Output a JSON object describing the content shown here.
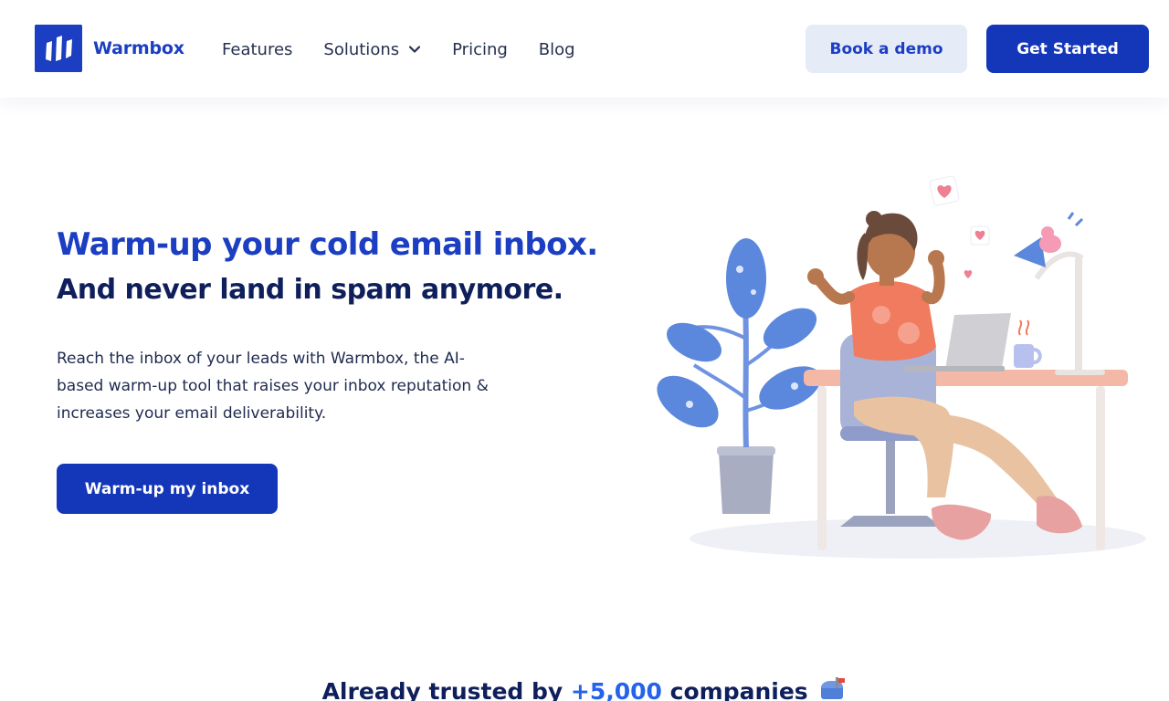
{
  "brand": {
    "name": "Warmbox",
    "color": "#1b3ec2"
  },
  "nav": {
    "items": [
      {
        "label": "Features"
      },
      {
        "label": "Solutions",
        "icon": "chevron-down-icon"
      },
      {
        "label": "Pricing"
      },
      {
        "label": "Blog"
      }
    ]
  },
  "header_actions": {
    "demo_label": "Book a demo",
    "start_label": "Get Started"
  },
  "hero": {
    "title": "Warm-up your cold email inbox.",
    "subtitle": "And never land in spam anymore.",
    "description": "Reach the inbox of your leads with Warmbox, the AI-based warm-up tool that raises your inbox reputation & increases your email deliverability.",
    "cta_label": "Warm-up my inbox"
  },
  "trusted": {
    "prefix": "Already trusted by",
    "count": "+5,000",
    "suffix": "companies",
    "icon": "mailbox-icon"
  },
  "colors": {
    "primary": "#1436b9",
    "accent": "#2563eb",
    "navy": "#0f1f5c",
    "demo_bg": "#e6ebf8"
  }
}
